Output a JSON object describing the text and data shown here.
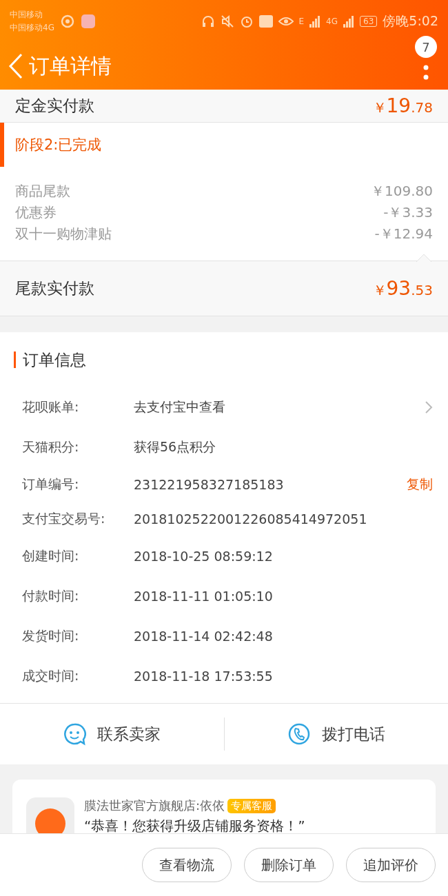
{
  "status_bar": {
    "carrier_1": "中国移动",
    "carrier_2": "中国移动4G",
    "network_1": "E",
    "network_2": "4G",
    "battery": "63",
    "time": "傍晚5:02"
  },
  "header": {
    "title": "订单详情",
    "badge": "7"
  },
  "deposit": {
    "label": "定金实付款",
    "currency": "￥",
    "amount_int": "19",
    "amount_dec": ".78"
  },
  "stage": {
    "title": "阶段2:已完成",
    "items": [
      {
        "label": "商品尾款",
        "value": "￥109.80"
      },
      {
        "label": "优惠券",
        "value": "-￥3.33"
      },
      {
        "label": "双十一购物津贴",
        "value": "-￥12.94"
      }
    ]
  },
  "final_payment": {
    "label": "尾款实付款",
    "currency": "￥",
    "amount_int": "93",
    "amount_dec": ".53"
  },
  "order_info": {
    "title": "订单信息",
    "rows": [
      {
        "label": "花呗账单:",
        "value": "去支付宝中查看",
        "kind": "link"
      },
      {
        "label": "天猫积分:",
        "value": "获得56点积分",
        "kind": "plain"
      },
      {
        "label": "订单编号:",
        "value": "231221958327185183",
        "kind": "copy",
        "action": "复制"
      },
      {
        "label": "支付宝交易号:",
        "value": "2018102522001226085414972051",
        "kind": "plain"
      },
      {
        "label": "创建时间:",
        "value": "2018-10-25 08:59:12",
        "kind": "plain"
      },
      {
        "label": "付款时间:",
        "value": "2018-11-11 01:05:10",
        "kind": "plain"
      },
      {
        "label": "发货时间:",
        "value": "2018-11-14 02:42:48",
        "kind": "plain"
      },
      {
        "label": "成交时间:",
        "value": "2018-11-18 17:53:55",
        "kind": "plain"
      }
    ]
  },
  "contact": [
    {
      "label": "联系卖家",
      "kind": "chat"
    },
    {
      "label": "拨打电话",
      "kind": "phone"
    }
  ],
  "service_card": {
    "shop": "膜法世家官方旗舰店:依依",
    "tag": "专属客服",
    "message": "“恭喜！您获得升级店铺服务资格！”"
  },
  "actions": [
    "查看物流",
    "删除订单",
    "追加评价"
  ]
}
